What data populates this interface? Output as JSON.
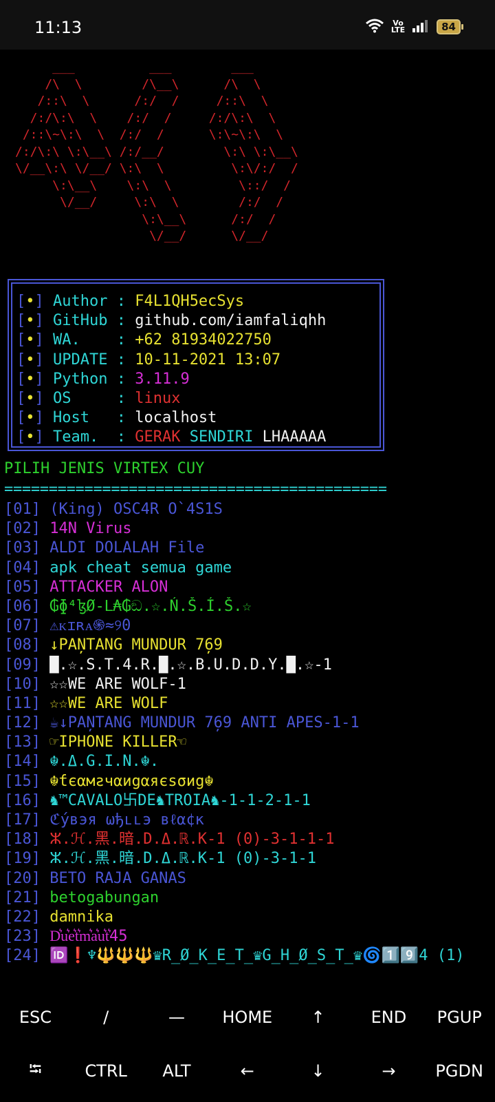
{
  "status_bar": {
    "time": "11:13",
    "wifi_icon": "wifi-icon",
    "volte": "Vo\nLTE",
    "signal_icon": "signal-icon",
    "battery": "84"
  },
  "terminal": {
    "logo_ascii": "     ___          ___        ___\n    /\\  \\        /\\__\\      /\\  \\\n   /::\\  \\      /:/  /     /::\\  \\\n  /:/\\:\\  \\    /:/  /     /:/\\:\\  \\\n /::\\~\\:\\  \\  /:/  /      \\:\\~\\:\\  \\\n/:/\\:\\ \\:\\__\\ /:/__/        \\:\\ \\:\\__\\\n\\/__\\:\\ \\/__/ \\:\\  \\         \\:\\/:/  /\n     \\:\\__\\    \\:\\  \\         \\::/  /\n      \\/__/     \\:\\  \\        /:/  /\n                 \\:\\__\\      /:/  /\n                  \\/__/      \\/__/",
    "info": {
      "bullet_open": "[",
      "bullet_dot": "•",
      "bullet_close": "]",
      "rows": [
        {
          "label": "Author ",
          "sep": ":",
          "value": "F4L1QH5ecSys"
        },
        {
          "label": "GitHub ",
          "sep": ":",
          "value": "github.com/iamfaliqhh"
        },
        {
          "label": "WA.    ",
          "sep": ":",
          "value": "+62 81934022750"
        },
        {
          "label": "UPDATE ",
          "sep": ":",
          "value": "10-11-2021 13:07"
        },
        {
          "label": "Python ",
          "sep": ":",
          "value": "3.11.9"
        },
        {
          "label": "OS     ",
          "sep": ":",
          "value": "linux"
        },
        {
          "label": "Host   ",
          "sep": ":",
          "value": "localhost"
        },
        {
          "label": "Team.  ",
          "sep": ":",
          "value_parts": [
            "GERAK",
            "SENDIRI",
            "LHAAAAA"
          ]
        }
      ]
    },
    "menu_title": "PILIH JENIS VIRTEX CUY",
    "divider": "===========================================",
    "menu": [
      {
        "idx": "[01]",
        "text": "(King) OSC4R O`4S1S",
        "color": "#4a56d6"
      },
      {
        "idx": "[02]",
        "text": "14N Virus",
        "color": "#d62fd6"
      },
      {
        "idx": "[03]",
        "text": "ALDI DOLALAH File",
        "color": "#4a56d6"
      },
      {
        "idx": "[04]",
        "text": "apk cheat semua game",
        "color": "#2fd6d6"
      },
      {
        "idx": "[05]",
        "text": "ATTACKER ALON",
        "color": "#d62fd6"
      },
      {
        "idx": "[06]",
        "text": "₲ɸ⁴ɮØ-ᒪ₳₲ඞ.☆.Ń.Š.Í.Š.☆",
        "color": "#2ed12e"
      },
      {
        "idx": "[07]",
        "text": "⚠ᴋɪʀᴀ֍≈୨0",
        "color": "#4a56d6"
      },
      {
        "idx": "[08]",
        "text": "↓PAN̦TANG MUNDUR 7̦69",
        "color": "#e7e131"
      },
      {
        "idx": "[09]",
        "text": "█.☆.S.T.4.R.█.☆.B.U.D.D.Y.█.☆-1",
        "color": "#f2f2f2"
      },
      {
        "idx": "[10]",
        "text": "☆☆WE ARE WOLF-1",
        "color": "#f2f2f2"
      },
      {
        "idx": "[11]",
        "text": "☆☆WE ARE WOLF",
        "color": "#e7e131"
      },
      {
        "idx": "[12]",
        "text": "☕↓PAN̦TANG MUNDUR 7̦69 ANTI APES-1-1",
        "color": "#4a56d6"
      },
      {
        "idx": "[13]",
        "text": "☞IPHONE KILLER☜",
        "color": "#e7e131"
      },
      {
        "idx": "[14]",
        "text": "☬.Δ.G.I.N.☬.",
        "color": "#2fd6d6"
      },
      {
        "idx": "[15]",
        "text": "☬ƭєαмƨчαиgαяєѕσиg☬",
        "color": "#e7e131"
      },
      {
        "idx": "[16]",
        "text": "♞™CAVALO卐DE♞TROIA♞-1-1-2-1-1",
        "color": "#2fd6d6"
      },
      {
        "idx": "[17]",
        "text": "ℭýвэя ωђււэ вℓα¢к",
        "color": "#4a56d6"
      },
      {
        "idx": "[18]",
        "text": "ⵣ.ℋ.黑.暗.D.Δ.ℝ.K-1 (0)-3-1-1-1",
        "color": "#e03131"
      },
      {
        "idx": "[19]",
        "text": "ⵣ.ℋ.黑.暗.D.Δ.ℝ.K-1 (0)-3-1-1",
        "color": "#2fd6d6"
      },
      {
        "idx": "[20]",
        "text": "BETO RAJA GANAS",
        "color": "#4a56d6"
      },
      {
        "idx": "[21]",
        "text": "betogabungan",
        "color": "#2ed12e"
      },
      {
        "idx": "[22]",
        "text": "damnika",
        "color": "#e7e131"
      },
      {
        "idx": "[23]",
        "text": "D͛u͛e͛t͛m͛a͛u͛t͛45",
        "color": "#d62fd6"
      },
      {
        "idx": "[24]",
        "text": "🆔❗♆🔱🔱🔱♛R̲Ø̲K̲E̲T̲♛G̲H̲Ø̲S̲T̲♛🌀1️⃣9️⃣4 (1)",
        "color": "#2fd6d6"
      }
    ]
  },
  "extra_keys": {
    "row1": [
      "ESC",
      "/",
      "—",
      "HOME",
      "↑",
      "END",
      "PGUP"
    ],
    "row2": [
      "⭾",
      "CTRL",
      "ALT",
      "←",
      "↓",
      "→",
      "PGDN"
    ]
  }
}
